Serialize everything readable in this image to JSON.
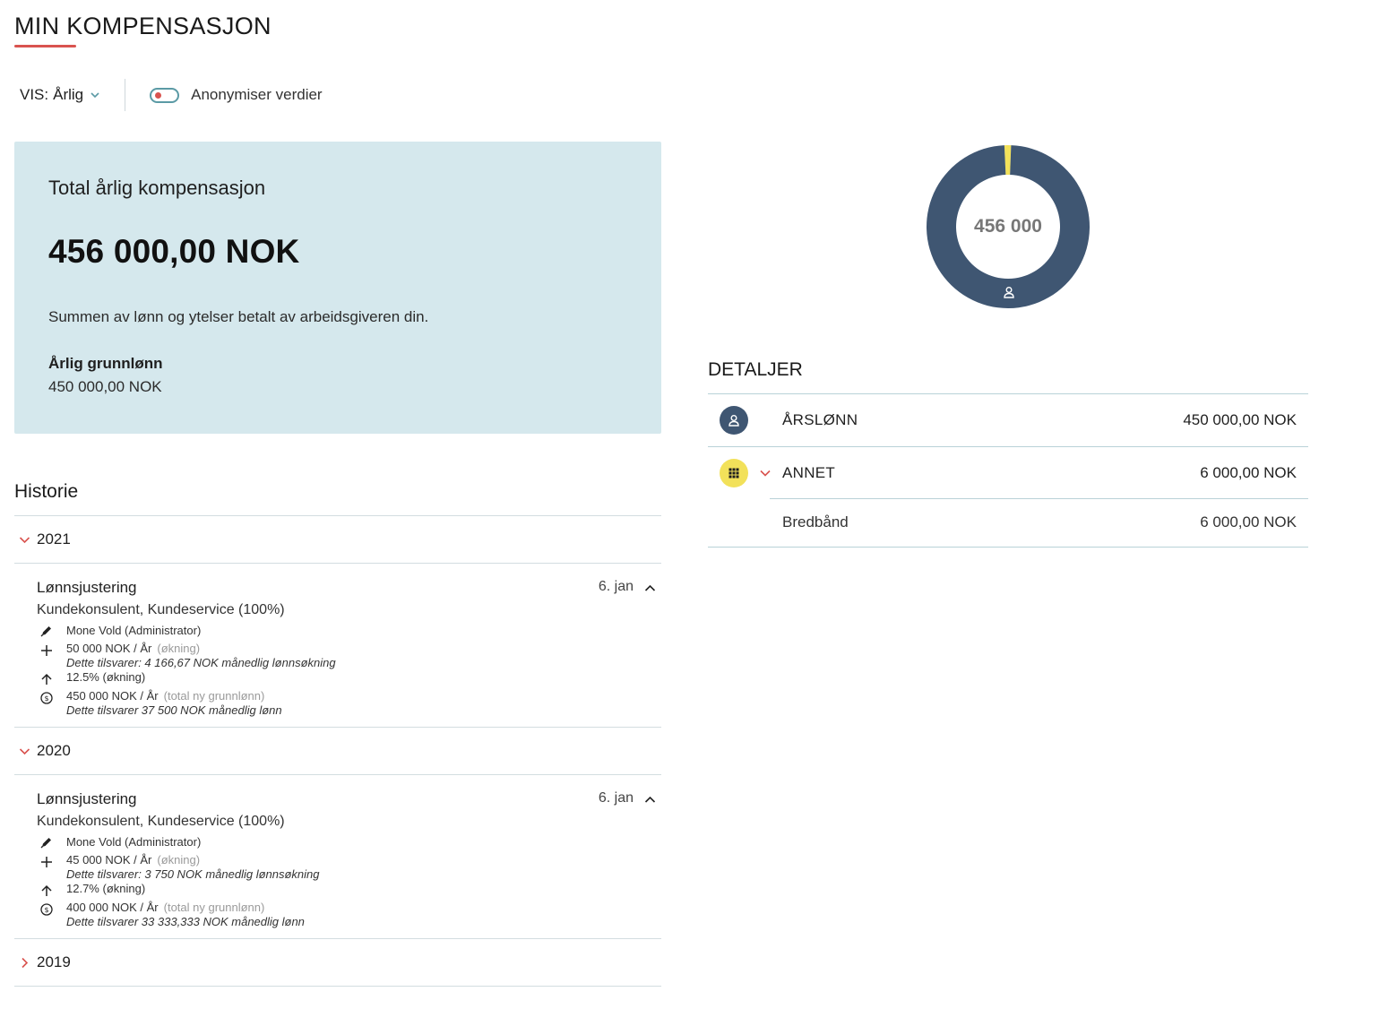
{
  "header": {
    "title": "MIN KOMPENSASJON"
  },
  "toolbar": {
    "vis_label": "VIS:",
    "vis_value": "Årlig",
    "toggle_label": "Anonymiser verdier"
  },
  "total_card": {
    "title": "Total årlig kompensasjon",
    "amount": "456 000,00 NOK",
    "description": "Summen av lønn og ytelser betalt av arbeidsgiveren din.",
    "base_label": "Årlig grunnlønn",
    "base_value": "450 000,00 NOK"
  },
  "donut": {
    "center_label": "456 000",
    "segments": [
      {
        "name": "ÅRSLØNN",
        "value": 450000,
        "color": "#3f5672"
      },
      {
        "name": "ANNET",
        "value": 6000,
        "color": "#f2e15a"
      }
    ]
  },
  "details": {
    "title": "DETALJER",
    "rows": [
      {
        "label": "ÅRSLØNN",
        "value": "450 000,00 NOK",
        "icon": "person-icon",
        "icon_color": "#3f5672"
      },
      {
        "label": "ANNET",
        "value": "6 000,00 NOK",
        "icon": "grid-icon",
        "icon_color": "#f2e15a"
      },
      {
        "label": "Bredbånd",
        "value": "6 000,00 NOK"
      }
    ]
  },
  "history": {
    "title": "Historie",
    "years": [
      {
        "year": "2021",
        "entry": {
          "title": "Lønnsjustering",
          "date": "6. jan",
          "position": "Kundekonsulent, Kundeservice (100%)",
          "author": "Mone Vold (Administrator)",
          "increase": "50 000 NOK / År",
          "increase_note": "(økning)",
          "increase_monthly": "Dette tilsvarer: 4 166,67 NOK månedlig lønnsøkning",
          "percent": "12.5%",
          "percent_note": "(økning)",
          "total": "450 000 NOK / År",
          "total_note": "(total ny grunnlønn)",
          "total_monthly": "Dette tilsvarer 37 500 NOK månedlig lønn"
        }
      },
      {
        "year": "2020",
        "entry": {
          "title": "Lønnsjustering",
          "date": "6. jan",
          "position": "Kundekonsulent, Kundeservice (100%)",
          "author": "Mone Vold (Administrator)",
          "increase": "45 000 NOK / År",
          "increase_note": "(økning)",
          "increase_monthly": "Dette tilsvarer: 3 750 NOK månedlig lønnsøkning",
          "percent": "12.7%",
          "percent_note": "(økning)",
          "total": "400 000 NOK / År",
          "total_note": "(total ny grunnlønn)",
          "total_monthly": "Dette tilsvarer 33 333,333 NOK månedlig lønn"
        }
      },
      {
        "year": "2019"
      }
    ]
  },
  "colors": {
    "accent_red": "#d9534f",
    "card_bg": "#d5e8ed",
    "donut_main": "#3f5672",
    "donut_other": "#f2e15a",
    "toggle_border": "#5b9aa5"
  }
}
